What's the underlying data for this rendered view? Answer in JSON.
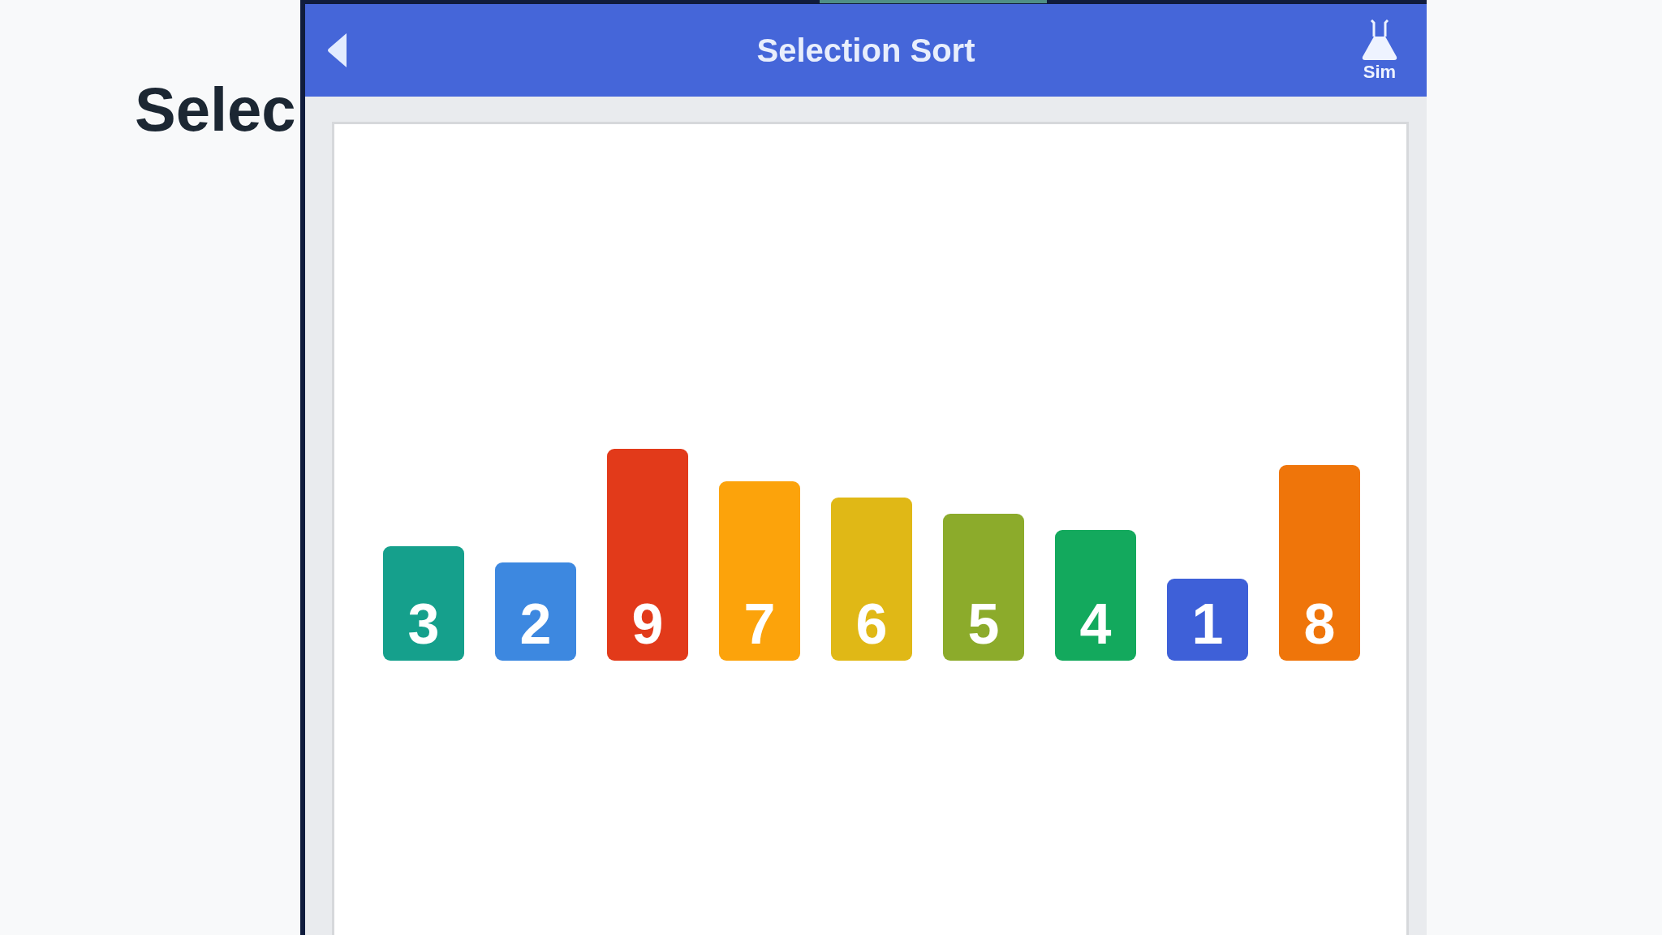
{
  "page": {
    "heading": "Selec"
  },
  "app": {
    "header": {
      "title": "Selection Sort",
      "sim_button": "Sim"
    },
    "canvas": {
      "bars": [
        {
          "value": "3",
          "color": "#15a08c"
        },
        {
          "value": "2",
          "color": "#3d88e0"
        },
        {
          "value": "9",
          "color": "#e23a1a"
        },
        {
          "value": "7",
          "color": "#fca30b"
        },
        {
          "value": "6",
          "color": "#e0b816"
        },
        {
          "value": "5",
          "color": "#8cab2b"
        },
        {
          "value": "4",
          "color": "#13a95d"
        },
        {
          "value": "1",
          "color": "#3e60d8"
        },
        {
          "value": "8",
          "color": "#ef750a"
        }
      ]
    }
  }
}
